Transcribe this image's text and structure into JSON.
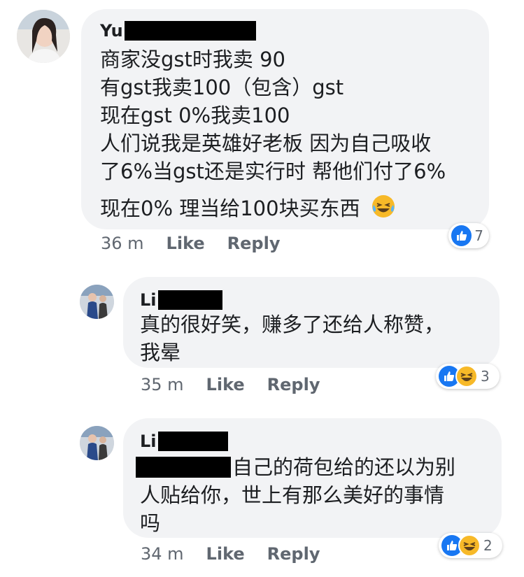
{
  "comments": [
    {
      "author_visible": "Yu",
      "lines": [
        "商家没gst时我卖 90",
        "有gst我卖100（包含）gst",
        "现在gst 0%我卖100",
        "人们说我是英雄好老板 因为自己吸收",
        "了6%当gst还是实行时 帮他们付了6%",
        "现在0% 理当给100块买东西"
      ],
      "emoji": "laughing-tears",
      "time": "36 m",
      "like_label": "Like",
      "reply_label": "Reply",
      "reaction_count": "7"
    },
    {
      "author_visible": "Li",
      "lines": [
        "真的很好笑，赚多了还给人称赞，",
        "我晕"
      ],
      "time": "35 m",
      "like_label": "Like",
      "reply_label": "Reply",
      "reaction_count": "3"
    },
    {
      "author_visible": "Li",
      "first_line_text": "自己的荷包给的还以为别",
      "lines": [
        "人贴给你，世上有那么美好的事情",
        "吗"
      ],
      "time": "34 m",
      "like_label": "Like",
      "reply_label": "Reply",
      "reaction_count": "2"
    }
  ],
  "colors": {
    "bubble": "#f2f3f5",
    "meta_text": "#606770",
    "like_blue": "#1877f2",
    "haha_yellow": "#f7b928"
  }
}
